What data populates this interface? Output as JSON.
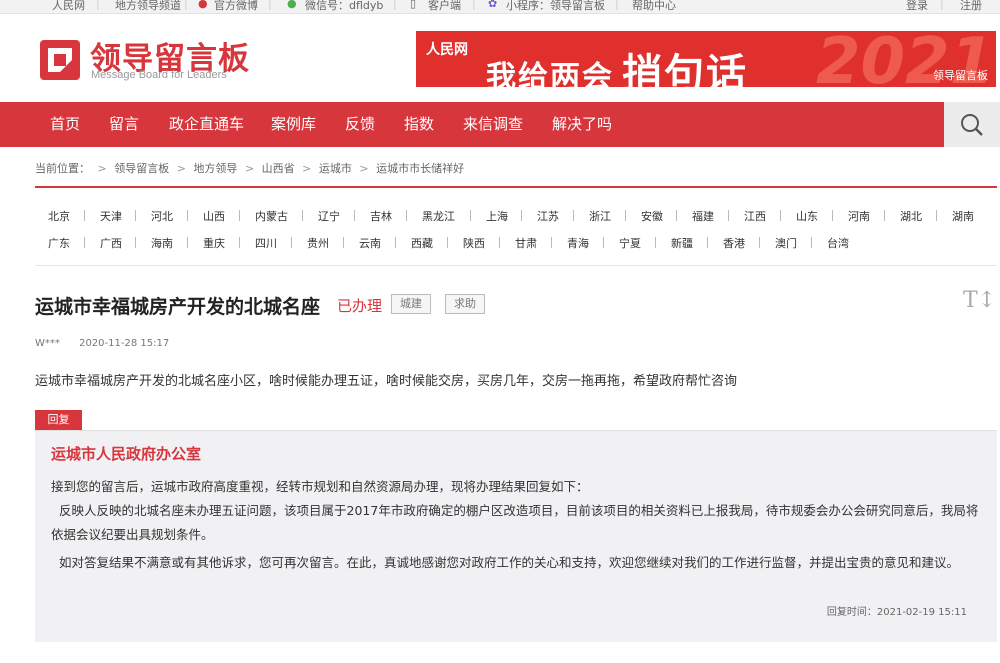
{
  "topbar": {
    "items": [
      "人民网",
      "地方领导频道",
      "官方微博",
      "微信号：dfldyb",
      "客户端",
      "小程序：领导留言板",
      "帮助中心"
    ],
    "login": "登录",
    "register": "注册"
  },
  "logo": {
    "cn": "领导留言板",
    "en": "Message Board for Leaders"
  },
  "banner": {
    "site": "人民网",
    "line1": "我给两会",
    "line2": "捎句话",
    "year": "2021",
    "brand": "领导留言板"
  },
  "nav": {
    "items": [
      "首页",
      "留言",
      "政企直通车",
      "案例库",
      "反馈",
      "指数",
      "来信调查",
      "解决了吗"
    ]
  },
  "breadcrumb": {
    "label": "当前位置：",
    "items": [
      "领导留言板",
      "地方领导",
      "山西省",
      "运城市",
      "运城市市长储祥好"
    ]
  },
  "provinces": {
    "row1": [
      "北京",
      "天津",
      "河北",
      "山西",
      "内蒙古",
      "辽宁",
      "吉林",
      "黑龙江",
      "上海",
      "江苏",
      "浙江",
      "安徽",
      "福建",
      "江西",
      "山东",
      "河南",
      "湖北",
      "湖南"
    ],
    "row2": [
      "广东",
      "广西",
      "海南",
      "重庆",
      "四川",
      "贵州",
      "云南",
      "西藏",
      "陕西",
      "甘肃",
      "青海",
      "宁夏",
      "新疆",
      "香港",
      "澳门",
      "台湾"
    ]
  },
  "message": {
    "title": "运城市幸福城房产开发的北城名座",
    "status": "已办理",
    "tags": [
      "城建",
      "求助"
    ],
    "author": "W***",
    "time": "2020-11-28 15:17",
    "content": "运城市幸福城房产开发的北城名座小区，啥时候能办理五证，啥时候能交房，买房几年，交房一拖再拖，希望政府帮忙咨询"
  },
  "reply": {
    "label": "回复",
    "org": "运城市人民政府办公室",
    "p1": "接到您的留言后，运城市政府高度重视，经转市规划和自然资源局办理，现将办理结果回复如下：",
    "p2": "反映人反映的北城名座未办理五证问题，该项目属于2017年市政府确定的棚户区改造项目，目前该项目的相关资料已上报我局，待市规委会办公会研究同意后，我局将依据会议纪要出具规划条件。",
    "p3": "如对答复结果不满意或有其他诉求，您可再次留言。在此，真诚地感谢您对政府工作的关心和支持，欢迎您继续对我们的工作进行监督，并提出宝贵的意见和建议。",
    "time_label": "回复时间：",
    "time": "2021-02-19 15:11"
  },
  "colors": {
    "brand_red": "#d8363d",
    "reply_bg": "#f1f1f3"
  },
  "icons": {
    "search": "search-icon",
    "font_size": "font-size-icon"
  }
}
